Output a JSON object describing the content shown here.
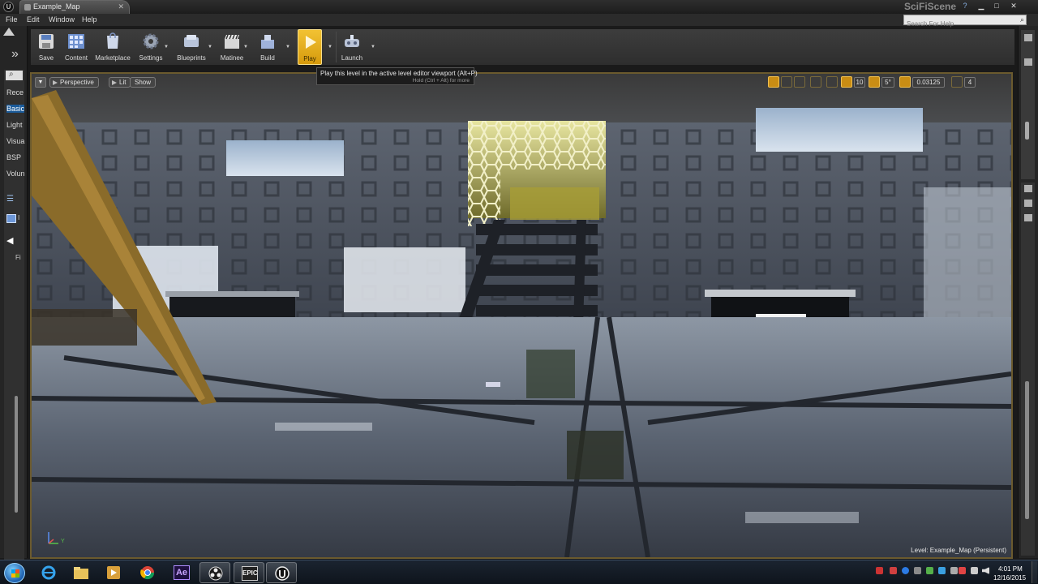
{
  "window": {
    "document_tab": "Example_Map",
    "project_name": "SciFiScene",
    "help_icon": "?",
    "minimize_icon": "▁",
    "maximize_icon": "□",
    "close_icon": "✕",
    "tab_close_icon": "✕"
  },
  "menu": {
    "items": [
      "File",
      "Edit",
      "Window",
      "Help"
    ],
    "search_placeholder": "Search For Help"
  },
  "modes_panel": {
    "categories": [
      {
        "label": "Rece",
        "selected": false
      },
      {
        "label": "Basic",
        "selected": true
      },
      {
        "label": "Light",
        "selected": false
      },
      {
        "label": "Visua",
        "selected": false
      },
      {
        "label": "BSP",
        "selected": false
      },
      {
        "label": "Volun",
        "selected": false
      }
    ],
    "item_label": "I",
    "folder_label": "Fi"
  },
  "toolbar": {
    "buttons": [
      {
        "label": "Save",
        "icon": "save-icon"
      },
      {
        "label": "Content",
        "icon": "content-browser-icon"
      },
      {
        "label": "Marketplace",
        "icon": "marketplace-icon"
      },
      {
        "label": "Settings",
        "icon": "settings-icon"
      },
      {
        "label": "Blueprints",
        "icon": "blueprints-icon"
      },
      {
        "label": "Matinee",
        "icon": "matinee-icon"
      },
      {
        "label": "Build",
        "icon": "build-icon"
      },
      {
        "label": "Play",
        "icon": "play-icon"
      },
      {
        "label": "Launch",
        "icon": "launch-icon"
      }
    ],
    "accent": "#e2a818"
  },
  "tooltip": {
    "line1": "Play this level in the active level editor viewport (Alt+P)",
    "line2": "Hold (Ctrl + Alt) for more"
  },
  "viewport": {
    "view_mode": "Perspective",
    "lighting_mode": "Lit",
    "show_label": "Show",
    "grid_snap": "10",
    "rotation_snap": "5°",
    "scale_snap": "0.03125",
    "camera_speed": "4",
    "level_label": "Level:  Example_Map (Persistent)",
    "axis_label": "Y"
  },
  "taskbar": {
    "apps": [
      {
        "name": "internet-explorer-icon",
        "active": false
      },
      {
        "name": "file-explorer-icon",
        "active": false
      },
      {
        "name": "media-player-icon",
        "active": false
      },
      {
        "name": "chrome-icon",
        "active": false
      },
      {
        "name": "after-effects-icon",
        "active": false,
        "text": "Ae"
      },
      {
        "name": "obs-icon",
        "active": true
      },
      {
        "name": "epic-launcher-icon",
        "active": true,
        "text": "EPIC"
      },
      {
        "name": "unreal-editor-icon",
        "active": true
      }
    ],
    "time": "4:01 PM",
    "date": "12/16/2015"
  }
}
